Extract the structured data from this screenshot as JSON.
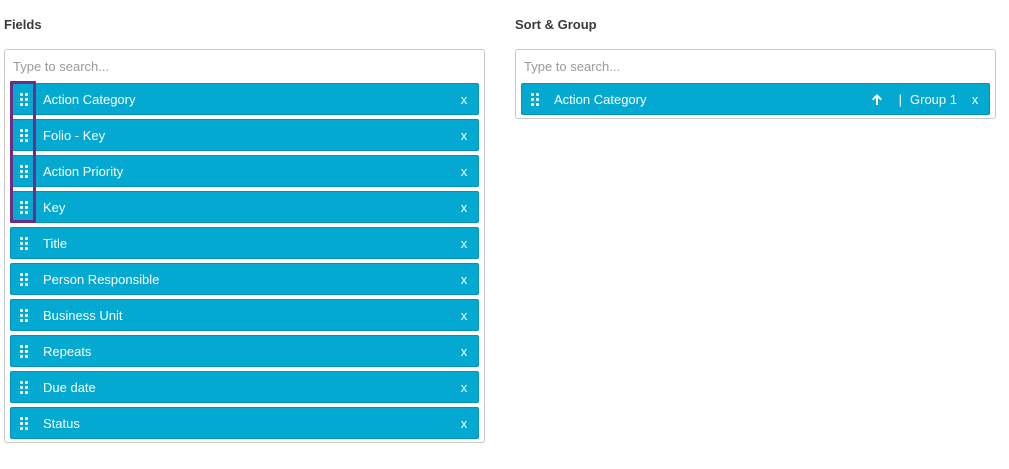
{
  "fields_panel": {
    "title": "Fields",
    "search_placeholder": "Type to search...",
    "items": [
      {
        "label": "Action Category",
        "remove": "x"
      },
      {
        "label": "Folio - Key",
        "remove": "x"
      },
      {
        "label": "Action Priority",
        "remove": "x"
      },
      {
        "label": "Key",
        "remove": "x"
      },
      {
        "label": "Title",
        "remove": "x"
      },
      {
        "label": "Person Responsible",
        "remove": "x"
      },
      {
        "label": "Business Unit",
        "remove": "x"
      },
      {
        "label": "Repeats",
        "remove": "x"
      },
      {
        "label": "Due date",
        "remove": "x"
      },
      {
        "label": "Status",
        "remove": "x"
      }
    ]
  },
  "sort_panel": {
    "title": "Sort & Group",
    "search_placeholder": "Type to search...",
    "items": [
      {
        "label": "Action Category",
        "sort_direction": "ascending",
        "separator": "|",
        "group": "Group 1",
        "remove": "x"
      }
    ]
  },
  "colors": {
    "chip_bg": "#04a9d1",
    "highlight": "#6b2c8a"
  },
  "icons": {
    "drag": "drag-handle-icon",
    "sort": "arrow-up-icon",
    "remove": "close-icon"
  }
}
